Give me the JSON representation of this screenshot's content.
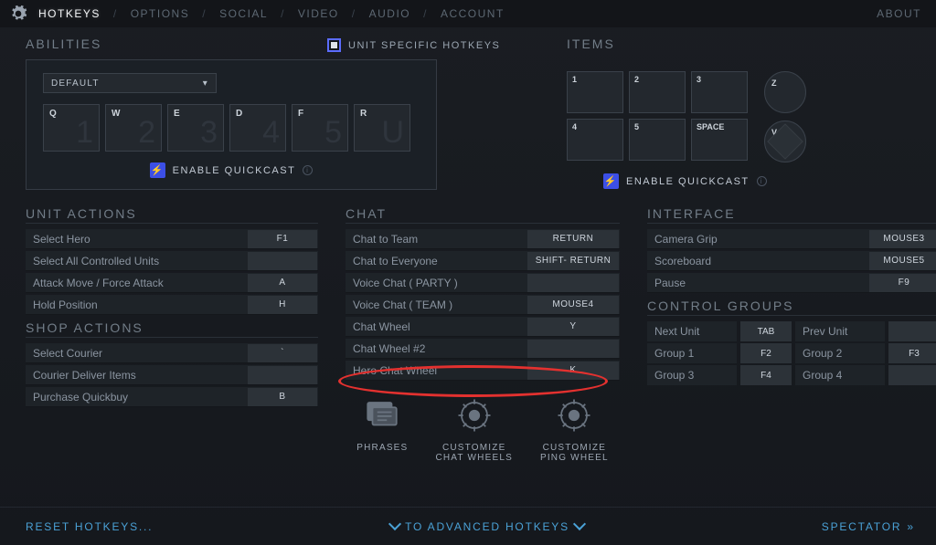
{
  "nav": {
    "tabs": [
      "HOTKEYS",
      "OPTIONS",
      "SOCIAL",
      "VIDEO",
      "AUDIO",
      "ACCOUNT"
    ],
    "active": 0,
    "about": "ABOUT"
  },
  "abilities": {
    "title": "ABILITIES",
    "preset": "DEFAULT",
    "unit_specific": "UNIT SPECIFIC HOTKEYS",
    "slots": [
      {
        "key": "Q",
        "big": "1"
      },
      {
        "key": "W",
        "big": "2"
      },
      {
        "key": "E",
        "big": "3"
      },
      {
        "key": "D",
        "big": "4"
      },
      {
        "key": "F",
        "big": "5"
      },
      {
        "key": "R",
        "big": "U"
      }
    ],
    "enable_qc": "ENABLE QUICKCAST"
  },
  "items": {
    "title": "ITEMS",
    "slots": [
      "1",
      "2",
      "3",
      "4",
      "5",
      "SPACE"
    ],
    "circle1": "Z",
    "circle2": "V",
    "enable_qc": "ENABLE QUICKCAST"
  },
  "unit_actions": {
    "title": "UNIT ACTIONS",
    "rows": [
      {
        "label": "Select Hero",
        "key": "F1"
      },
      {
        "label": "Select All Controlled Units",
        "key": ""
      },
      {
        "label": "Attack Move / Force Attack",
        "key": "A"
      },
      {
        "label": "Hold Position",
        "key": "H"
      }
    ]
  },
  "shop_actions": {
    "title": "SHOP ACTIONS",
    "rows": [
      {
        "label": "Select Courier",
        "key": "`"
      },
      {
        "label": "Courier Deliver Items",
        "key": ""
      },
      {
        "label": "Purchase Quickbuy",
        "key": "B"
      }
    ]
  },
  "chat": {
    "title": "CHAT",
    "rows": [
      {
        "label": "Chat to Team",
        "key": "RETURN"
      },
      {
        "label": "Chat to Everyone",
        "key": "SHIFT- RETURN"
      },
      {
        "label": "Voice Chat ( PARTY )",
        "key": ""
      },
      {
        "label": "Voice Chat ( TEAM )",
        "key": "MOUSE4"
      },
      {
        "label": "Chat Wheel",
        "key": "Y"
      },
      {
        "label": "Chat Wheel #2",
        "key": ""
      },
      {
        "label": "Hero Chat Wheel",
        "key": "K"
      }
    ],
    "buttons": [
      "PHRASES",
      "CUSTOMIZE\nCHAT WHEELS",
      "CUSTOMIZE\nPING WHEEL"
    ]
  },
  "interface": {
    "title": "INTERFACE",
    "rows": [
      {
        "label": "Camera Grip",
        "key": "MOUSE3"
      },
      {
        "label": "Scoreboard",
        "key": "MOUSE5"
      },
      {
        "label": "Pause",
        "key": "F9"
      }
    ]
  },
  "control_groups": {
    "title": "CONTROL GROUPS",
    "cells": [
      {
        "label": "Next Unit",
        "key": "TAB"
      },
      {
        "label": "Prev Unit",
        "key": ""
      },
      {
        "label": "Group 1",
        "key": "F2"
      },
      {
        "label": "Group 2",
        "key": "F3"
      },
      {
        "label": "Group 3",
        "key": "F4"
      },
      {
        "label": "Group 4",
        "key": ""
      }
    ]
  },
  "bottom": {
    "reset": "RESET HOTKEYS...",
    "advanced": "TO ADVANCED HOTKEYS",
    "spectator": "SPECTATOR"
  }
}
